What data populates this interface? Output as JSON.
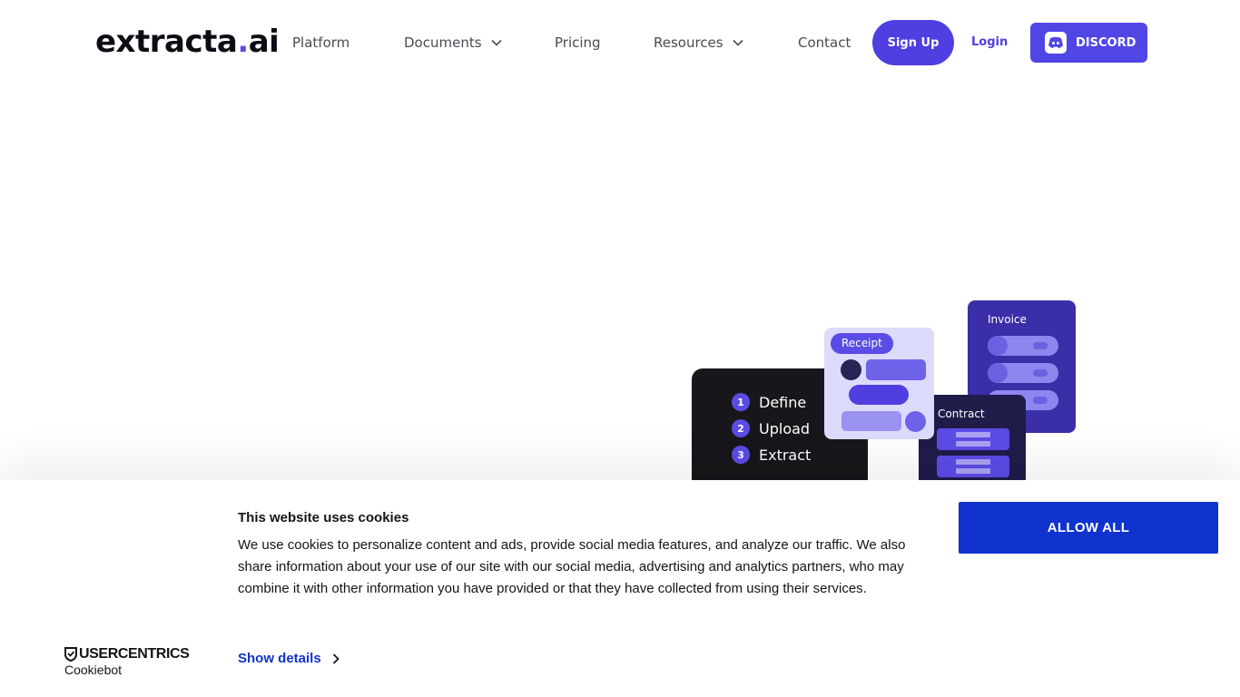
{
  "header": {
    "logo": {
      "main": "extracta",
      "dot": ".",
      "suffix": "ai"
    },
    "nav": [
      {
        "label": "Platform",
        "has_dropdown": false
      },
      {
        "label": "Documents",
        "has_dropdown": true
      },
      {
        "label": "Pricing",
        "has_dropdown": false
      },
      {
        "label": "Resources",
        "has_dropdown": true
      },
      {
        "label": "Contact",
        "has_dropdown": false
      }
    ],
    "signup_label": "Sign Up",
    "login_label": "Login",
    "discord_label": "DISCORD"
  },
  "illustration": {
    "steps": [
      {
        "num": "1",
        "label": "Define"
      },
      {
        "num": "2",
        "label": "Upload"
      },
      {
        "num": "3",
        "label": "Extract"
      }
    ],
    "receipt_label": "Receipt",
    "invoice_label": "Invoice",
    "contract_label": "Contract"
  },
  "cookie_banner": {
    "title": "This website uses cookies",
    "text": "We use cookies to personalize content and ads, provide social media features, and analyze our traffic. We also share information about your use of our site with our social media, advertising and analytics partners, who may combine it with other information you have provided or that they have collected from using their services.",
    "allow_all_label": "ALLOW ALL",
    "show_details_label": "Show details",
    "provider_brand": "USERCENTRICS",
    "provider_product": "Cookiebot"
  },
  "colors": {
    "brand_purple": "#4f3ee0",
    "cookie_button_blue": "#1032cf",
    "text_dark": "#141414"
  }
}
